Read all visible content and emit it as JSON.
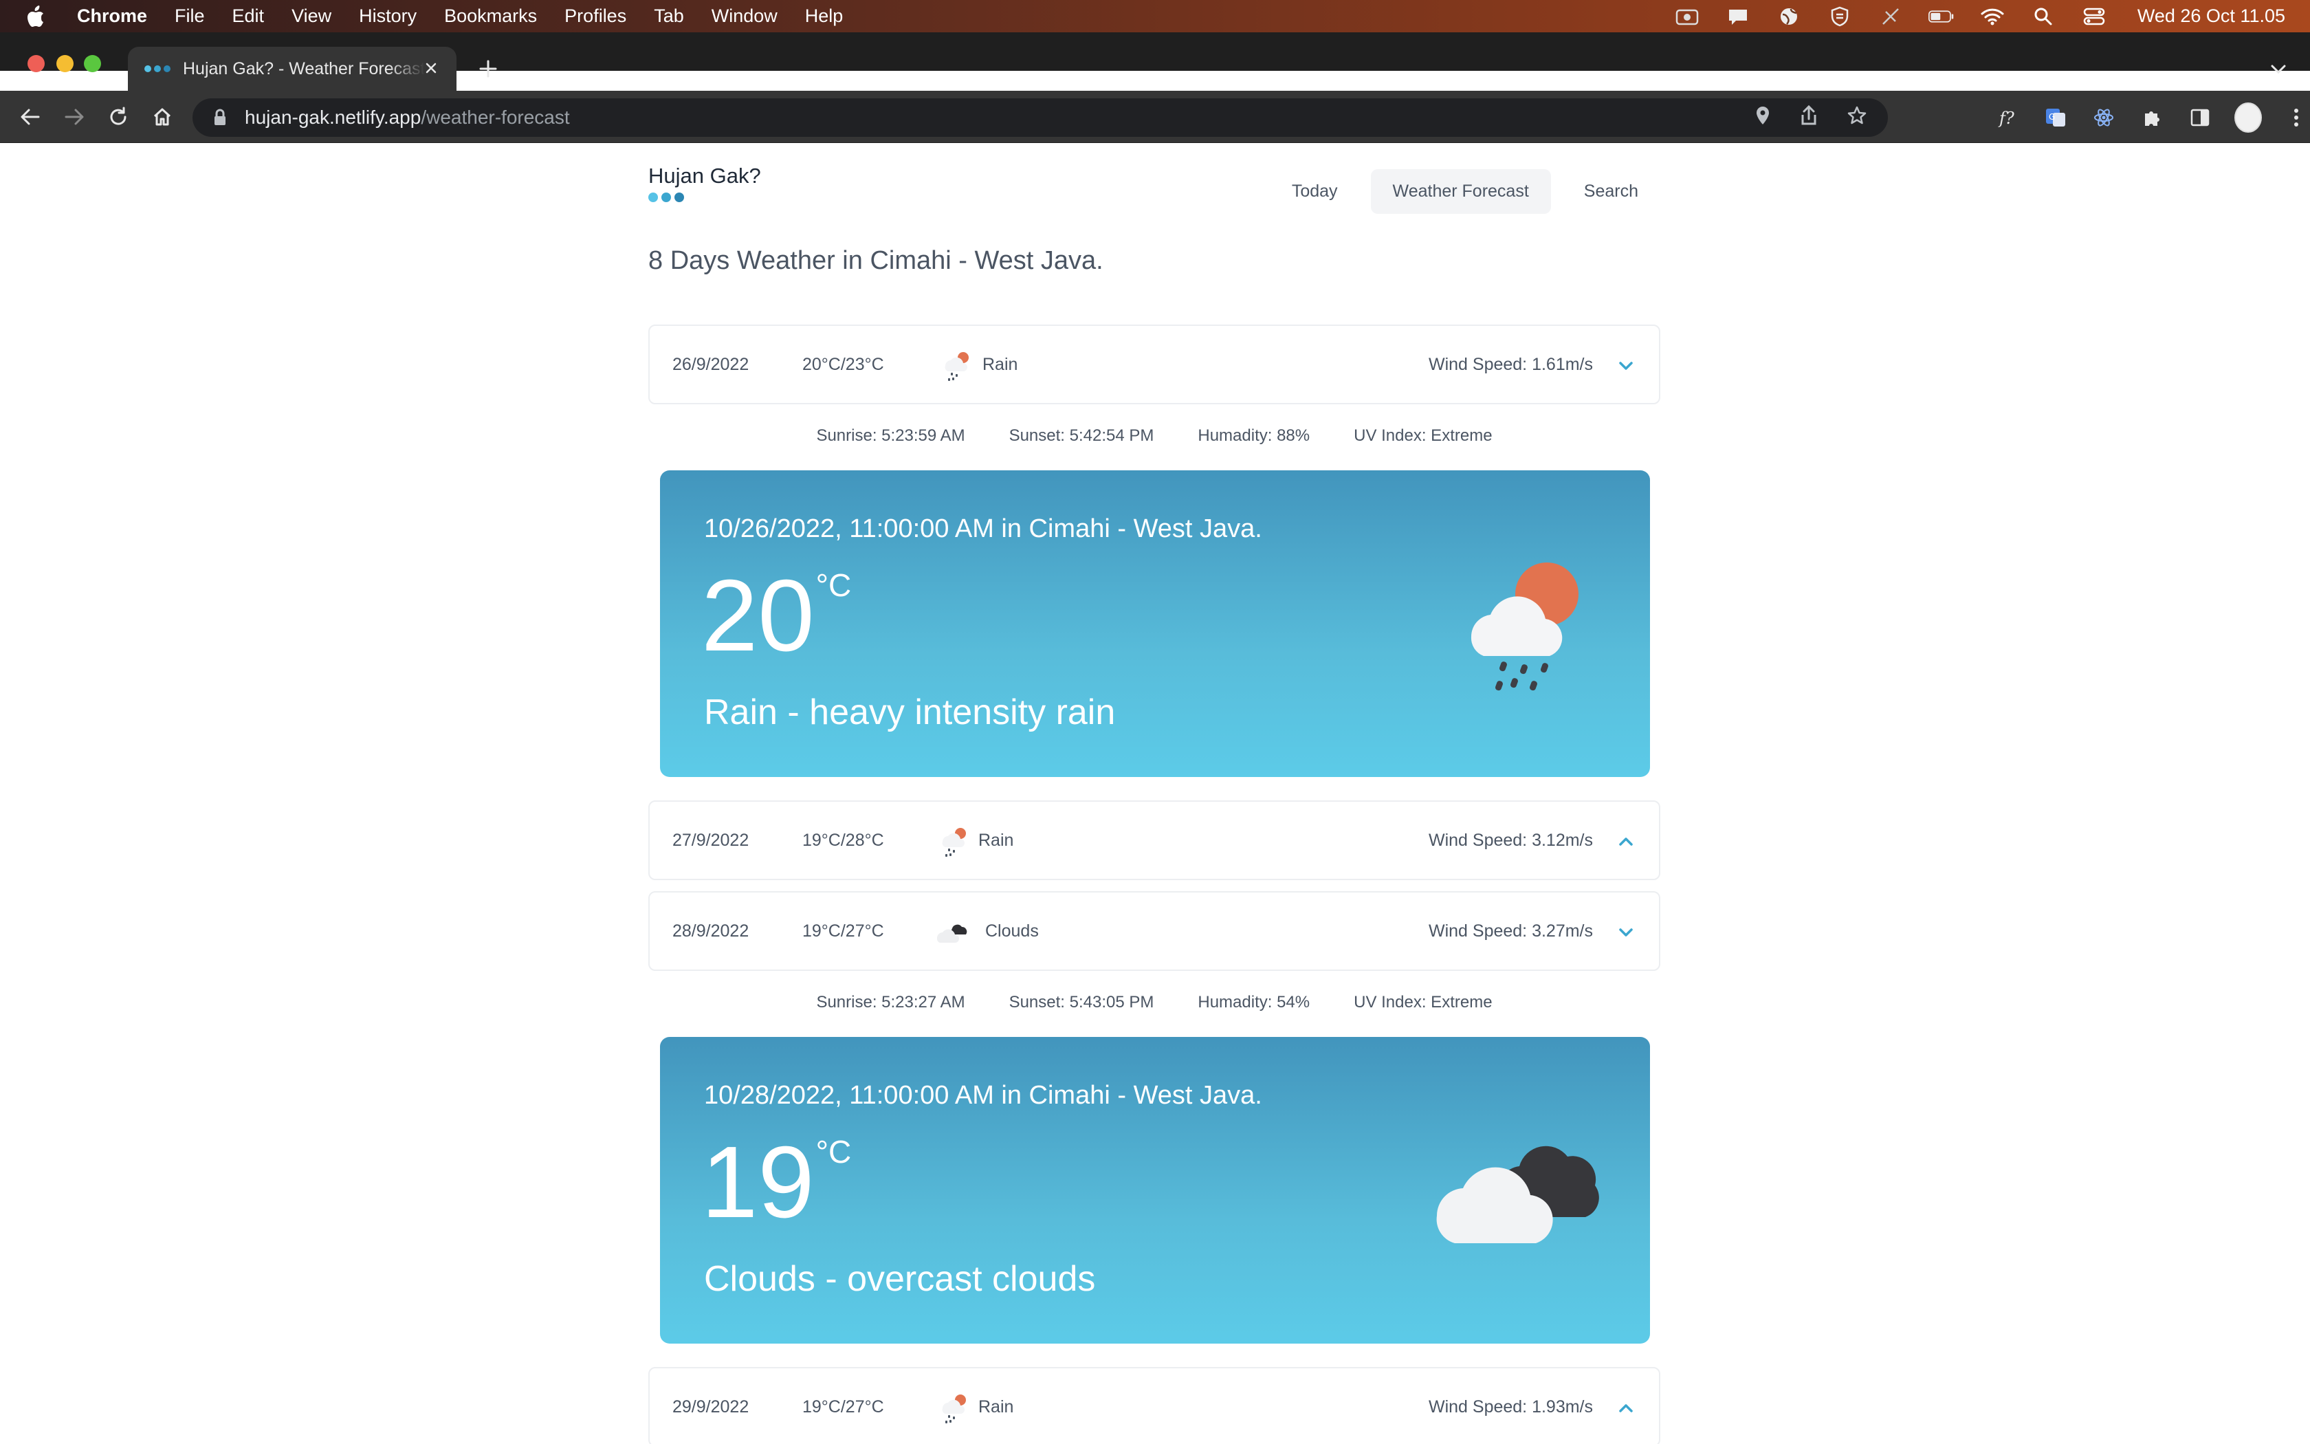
{
  "menubar": {
    "app_name": "Chrome",
    "items": [
      "File",
      "Edit",
      "View",
      "History",
      "Bookmarks",
      "Profiles",
      "Tab",
      "Window",
      "Help"
    ],
    "clock": "Wed 26 Oct  11.05"
  },
  "browser": {
    "tab_title": "Hujan Gak? - Weather Forecast",
    "url_host": "hujan-gak.netlify.app",
    "url_path": "/weather-forecast"
  },
  "site": {
    "brand": "Hujan Gak?",
    "brand_dot_colors": [
      "#56c2e6",
      "#3ba6cf",
      "#2b86b3"
    ],
    "nav": [
      "Today",
      "Weather Forecast",
      "Search"
    ],
    "active_nav": "Weather Forecast",
    "heading": "8 Days Weather in Cimahi - West Java."
  },
  "forecast": [
    {
      "date": "26/9/2022",
      "temp": "20°C/23°C",
      "weather": "Rain",
      "icon": "rain-sun-icon",
      "wind": "Wind Speed: 1.61m/s",
      "expanded": true,
      "details": {
        "sunrise": "Sunrise: 5:23:59 AM",
        "sunset": "Sunset: 5:42:54 PM",
        "humidity": "Humadity: 88%",
        "uv": "UV Index: Extreme"
      },
      "card": {
        "title": "10/26/2022, 11:00:00 AM in Cimahi - West Java.",
        "temperature": "20",
        "unit": "°C",
        "description": "Rain - heavy intensity rain"
      }
    },
    {
      "date": "27/9/2022",
      "temp": "19°C/28°C",
      "weather": "Rain",
      "icon": "rain-sun-icon",
      "wind": "Wind Speed: 3.12m/s",
      "expanded": false
    },
    {
      "date": "28/9/2022",
      "temp": "19°C/27°C",
      "weather": "Clouds",
      "icon": "dark-clouds-icon",
      "wind": "Wind Speed: 3.27m/s",
      "expanded": true,
      "details": {
        "sunrise": "Sunrise: 5:23:27 AM",
        "sunset": "Sunset: 5:43:05 PM",
        "humidity": "Humadity: 54%",
        "uv": "UV Index: Extreme"
      },
      "card": {
        "title": "10/28/2022, 11:00:00 AM in Cimahi - West Java.",
        "temperature": "19",
        "unit": "°C",
        "description": "Clouds - overcast clouds"
      }
    },
    {
      "date": "29/9/2022",
      "temp": "19°C/27°C",
      "weather": "Rain",
      "icon": "rain-sun-icon",
      "wind": "Wind Speed: 1.93m/s",
      "expanded": false
    }
  ],
  "colors": {
    "accent": "#4295bd",
    "card_gradient_end": "#5ccbe8",
    "chevron": "#3ba6cf",
    "sun": "#e2734f"
  }
}
